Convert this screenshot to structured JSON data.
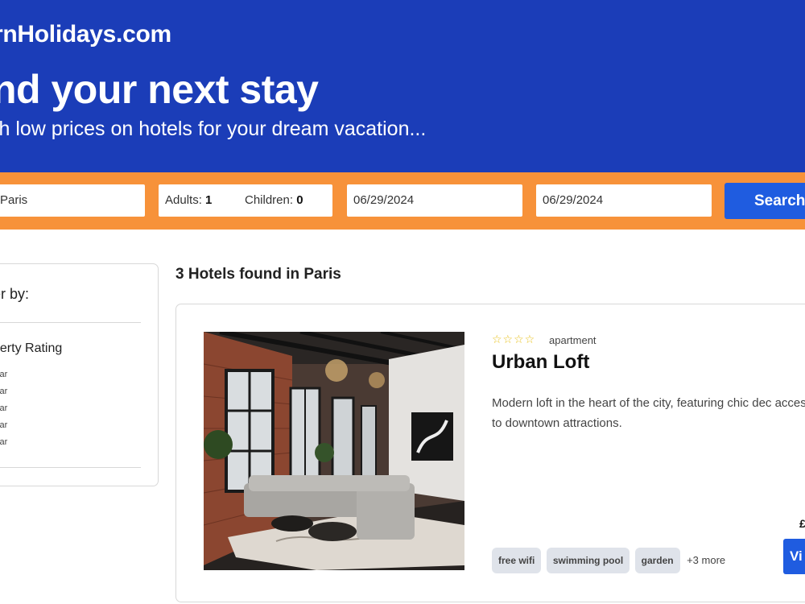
{
  "header": {
    "logo": "rnHolidays.com",
    "headline": "nd your next stay",
    "subline": "ch low prices on hotels for your dream vacation..."
  },
  "search": {
    "destination": "Paris",
    "adults_label": "Adults:",
    "adults_value": "1",
    "children_label": "Children:",
    "children_value": "0",
    "checkin": "06/29/2024",
    "checkout": "06/29/2024",
    "button_label": "Search"
  },
  "filters": {
    "title": "er by:",
    "rating_title": "perty Rating",
    "rating_options": [
      "star",
      "star",
      "star",
      "star",
      "star"
    ]
  },
  "results": {
    "title": "3 Hotels found in Paris"
  },
  "hotel": {
    "stars": "☆☆☆☆",
    "property_type": "apartment",
    "name": "Urban Loft",
    "description": "Modern loft in the heart of the city, featuring chic dec access to downtown attractions.",
    "amenities": [
      "free wifi",
      "swimming pool",
      "garden"
    ],
    "more_amenities": "+3 more",
    "price": "£",
    "view_button": "Vi"
  },
  "colors": {
    "header_blue": "#1b3db8",
    "search_orange": "#f7923a",
    "button_blue": "#1f5ce0",
    "star_yellow": "#e8c21e",
    "tag_gray": "#dfe3ea"
  },
  "icons": {
    "rating": "star-outline-icon"
  }
}
